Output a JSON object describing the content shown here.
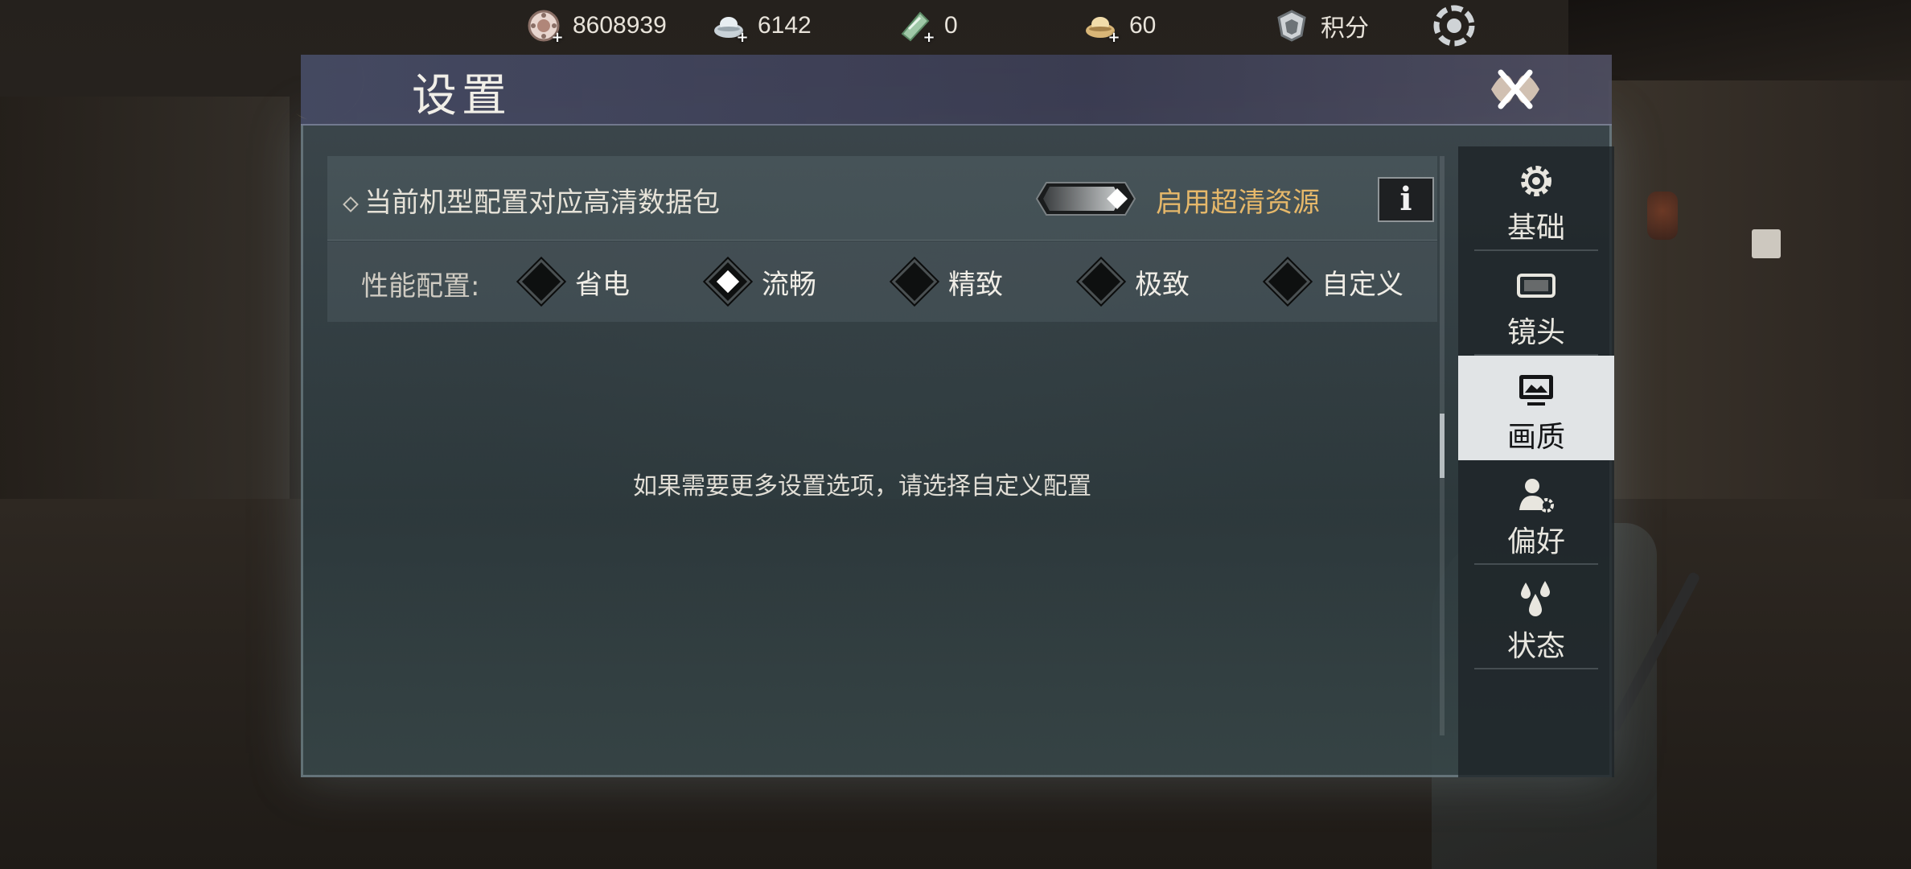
{
  "topbar": {
    "currencies": [
      {
        "icon": "coin-icon",
        "value": "8608939"
      },
      {
        "icon": "silver-ingot-icon",
        "value": "6142"
      },
      {
        "icon": "jade-ticket-icon",
        "value": "0"
      },
      {
        "icon": "gold-ingot-icon",
        "value": "60"
      }
    ],
    "points_label": "积分"
  },
  "panel": {
    "title": "设置",
    "hd_package_label": "当前机型配置对应高清数据包",
    "hd_toggle_label": "启用超清资源",
    "hd_toggle_on": true,
    "info_label": "i",
    "perf_label": "性能配置:",
    "perf_options": [
      {
        "label": "省电",
        "selected": false
      },
      {
        "label": "流畅",
        "selected": true
      },
      {
        "label": "精致",
        "selected": false
      },
      {
        "label": "极致",
        "selected": false
      },
      {
        "label": "自定义",
        "selected": false
      }
    ],
    "hint": "如果需要更多设置选项，请选择自定义配置"
  },
  "nav": {
    "items": [
      {
        "label": "基础",
        "icon": "gear-icon",
        "active": false
      },
      {
        "label": "镜头",
        "icon": "camera-frame-icon",
        "active": false
      },
      {
        "label": "画质",
        "icon": "monitor-icon",
        "active": true
      },
      {
        "label": "偏好",
        "icon": "user-settings-icon",
        "active": false
      },
      {
        "label": "状态",
        "icon": "droplets-icon",
        "active": false
      }
    ]
  },
  "colors": {
    "accent_gold": "#e6b86a",
    "active_tab_bg": "#e1e4e6",
    "header_bg": "#464b64"
  }
}
